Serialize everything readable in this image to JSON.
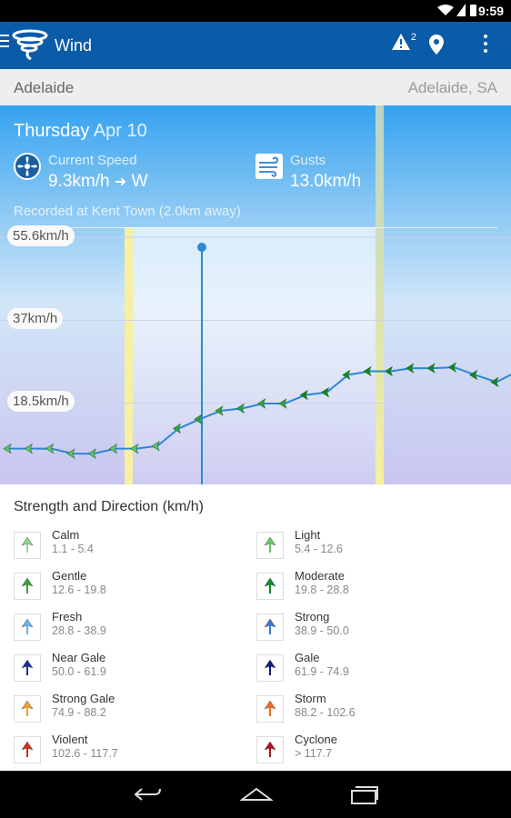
{
  "status": {
    "time": "9:59"
  },
  "app": {
    "title": "Wind",
    "warning_count": "2"
  },
  "location": {
    "left": "Adelaide",
    "right": "Adelaide, SA"
  },
  "current": {
    "day": "Thursday",
    "date": "Apr 10",
    "speed_label": "Current Speed",
    "speed_value": "9.3km/h",
    "direction_arrow": "➜",
    "direction": "W",
    "gusts_label": "Gusts",
    "gusts_value": "13.0km/h",
    "recorded": "Recorded at Kent Town (2.0km away)"
  },
  "chart_data": {
    "type": "line",
    "y_tick_labels": [
      "55.6km/h",
      "37km/h",
      "18.5km/h"
    ],
    "y_ticks": [
      55.6,
      37,
      18.5
    ],
    "ylim": [
      0,
      75
    ],
    "values": [
      8.3,
      8.3,
      8.3,
      7.2,
      7.2,
      8.3,
      8.3,
      8.9,
      12.8,
      14.9,
      16.8,
      17.3,
      18.4,
      18.4,
      20.3,
      20.9,
      24.8,
      25.6,
      25.6,
      26.3,
      26.3,
      26.5,
      24.8,
      23.2,
      25.6,
      25.2,
      25.2
    ],
    "grid": true
  },
  "legend": {
    "title": "Strength and Direction (km/h)",
    "items": [
      {
        "name": "Calm",
        "range": "1.1 - 5.4",
        "color": "#8fd98a"
      },
      {
        "name": "Light",
        "range": "5.4 - 12.6",
        "color": "#64c663"
      },
      {
        "name": "Gentle",
        "range": "12.6 - 19.8",
        "color": "#2fa63a"
      },
      {
        "name": "Moderate",
        "range": "19.8 - 28.8",
        "color": "#0f8a22"
      },
      {
        "name": "Fresh",
        "range": "28.8 - 38.9",
        "color": "#67b6ee"
      },
      {
        "name": "Strong",
        "range": "38.9 - 50.0",
        "color": "#3d76cf"
      },
      {
        "name": "Near Gale",
        "range": "50.0 - 61.9",
        "color": "#1a2e9a"
      },
      {
        "name": "Gale",
        "range": "61.9 - 74.9",
        "color": "#0b1a86"
      },
      {
        "name": "Strong Gale",
        "range": "74.9 - 88.2",
        "color": "#f3a12b"
      },
      {
        "name": "Storm",
        "range": "88.2 - 102.6",
        "color": "#ec6d1c"
      },
      {
        "name": "Violent",
        "range": "102.6 - 117.7",
        "color": "#d32f1f"
      },
      {
        "name": "Cyclone",
        "range": "> 117.7",
        "color": "#b0141a"
      }
    ]
  }
}
